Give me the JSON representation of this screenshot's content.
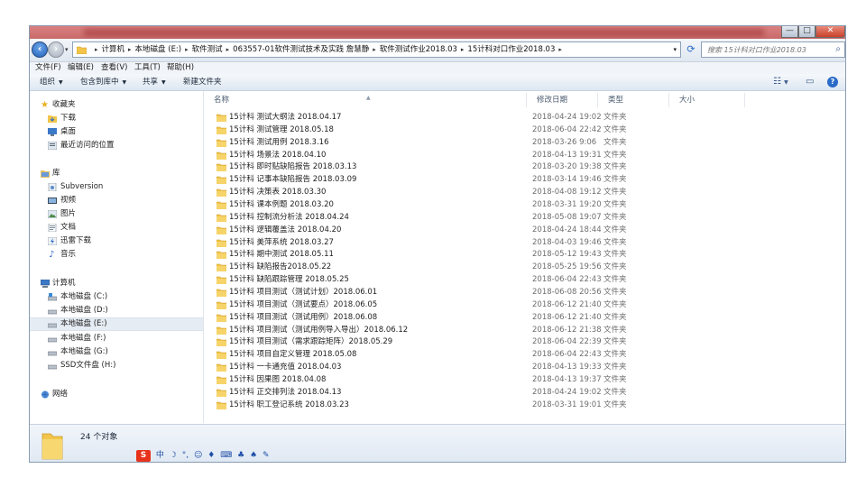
{
  "window": {
    "controls": {
      "minimize": "—",
      "maximize": "□",
      "close": "✕"
    }
  },
  "address": {
    "breadcrumbs": [
      "计算机",
      "本地磁盘 (E:)",
      "软件测试",
      "063557-01软件测试技术及实践 詹慧静",
      "软件测试作业2018.03",
      "15计科对口作业2018.03"
    ],
    "search_placeholder": "搜索 15计科对口作业2018.03"
  },
  "menu": [
    "文件(F)",
    "编辑(E)",
    "查看(V)",
    "工具(T)",
    "帮助(H)"
  ],
  "toolbar": {
    "organize": "组织",
    "include_library": "包含到库中",
    "share": "共享",
    "new_folder": "新建文件夹"
  },
  "nav": {
    "favorites": {
      "title": "收藏夹",
      "items": [
        "下载",
        "桌面",
        "最近访问的位置"
      ]
    },
    "libraries": {
      "title": "库",
      "items": [
        "Subversion",
        "视频",
        "图片",
        "文档",
        "迅雷下载",
        "音乐"
      ]
    },
    "computer": {
      "title": "计算机",
      "items": [
        "本地磁盘 (C:)",
        "本地磁盘 (D:)",
        "本地磁盘 (E:)",
        "本地磁盘 (F:)",
        "本地磁盘 (G:)",
        "SSD文件盘 (H:)"
      ]
    },
    "network": {
      "title": "网络"
    }
  },
  "columns": {
    "name": "名称",
    "date": "修改日期",
    "type": "类型",
    "size": "大小"
  },
  "files": [
    {
      "name": "15计科 测试大纲法 2018.04.17",
      "date": "2018-04-24 19:02",
      "type": "文件夹"
    },
    {
      "name": "15计科 测试管理 2018.05.18",
      "date": "2018-06-04 22:42",
      "type": "文件夹"
    },
    {
      "name": "15计科 测试用例 2018.3.16",
      "date": "2018-03-26 9:06",
      "type": "文件夹"
    },
    {
      "name": "15计科 场景法 2018.04.10",
      "date": "2018-04-13 19:31",
      "type": "文件夹"
    },
    {
      "name": "15计科 即时贴缺陷报告 2018.03.13",
      "date": "2018-03-20 19:38",
      "type": "文件夹"
    },
    {
      "name": "15计科 记事本缺陷报告 2018.03.09",
      "date": "2018-03-14 19:46",
      "type": "文件夹"
    },
    {
      "name": "15计科 决策表 2018.03.30",
      "date": "2018-04-08 19:12",
      "type": "文件夹"
    },
    {
      "name": "15计科 课本例题 2018.03.20",
      "date": "2018-03-31 19:20",
      "type": "文件夹"
    },
    {
      "name": "15计科 控制流分析法 2018.04.24",
      "date": "2018-05-08 19:07",
      "type": "文件夹"
    },
    {
      "name": "15计科 逻辑覆盖法 2018.04.20",
      "date": "2018-04-24 18:44",
      "type": "文件夹"
    },
    {
      "name": "15计科 美萍系统 2018.03.27",
      "date": "2018-04-03 19:46",
      "type": "文件夹"
    },
    {
      "name": "15计科 期中测试 2018.05.11",
      "date": "2018-05-12 19:43",
      "type": "文件夹"
    },
    {
      "name": "15计科 缺陷报告2018.05.22",
      "date": "2018-05-25 19:56",
      "type": "文件夹"
    },
    {
      "name": "15计科 缺陷跟踪管理 2018.05.25",
      "date": "2018-06-04 22:43",
      "type": "文件夹"
    },
    {
      "name": "15计科 项目测试（测试计划）2018.06.01",
      "date": "2018-06-08 20:56",
      "type": "文件夹"
    },
    {
      "name": "15计科 项目测试（测试要点）2018.06.05",
      "date": "2018-06-12 21:40",
      "type": "文件夹"
    },
    {
      "name": "15计科 项目测试（测试用例）2018.06.08",
      "date": "2018-06-12 21:40",
      "type": "文件夹"
    },
    {
      "name": "15计科 项目测试（测试用例导入导出）2018.06.12",
      "date": "2018-06-12 21:38",
      "type": "文件夹"
    },
    {
      "name": "15计科 项目测试（需求跟踪矩阵）2018.05.29",
      "date": "2018-06-04 22:39",
      "type": "文件夹"
    },
    {
      "name": "15计科 项目自定义管理 2018.05.08",
      "date": "2018-06-04 22:43",
      "type": "文件夹"
    },
    {
      "name": "15计科 一卡通充值 2018.04.03",
      "date": "2018-04-13 19:33",
      "type": "文件夹"
    },
    {
      "name": "15计科 因果图 2018.04.08",
      "date": "2018-04-13 19:37",
      "type": "文件夹"
    },
    {
      "name": "15计科 正交排列法 2018.04.13",
      "date": "2018-04-24 19:02",
      "type": "文件夹"
    },
    {
      "name": "15计科 职工登记系统 2018.03.23",
      "date": "2018-03-31 19:01",
      "type": "文件夹"
    }
  ],
  "status": {
    "count": "24 个对象"
  },
  "ime": {
    "logo": "S",
    "mode": "中"
  },
  "colors": {
    "folder": "#f2c54a",
    "selection": "#e6ecf4",
    "accent": "#2a6ac8"
  }
}
